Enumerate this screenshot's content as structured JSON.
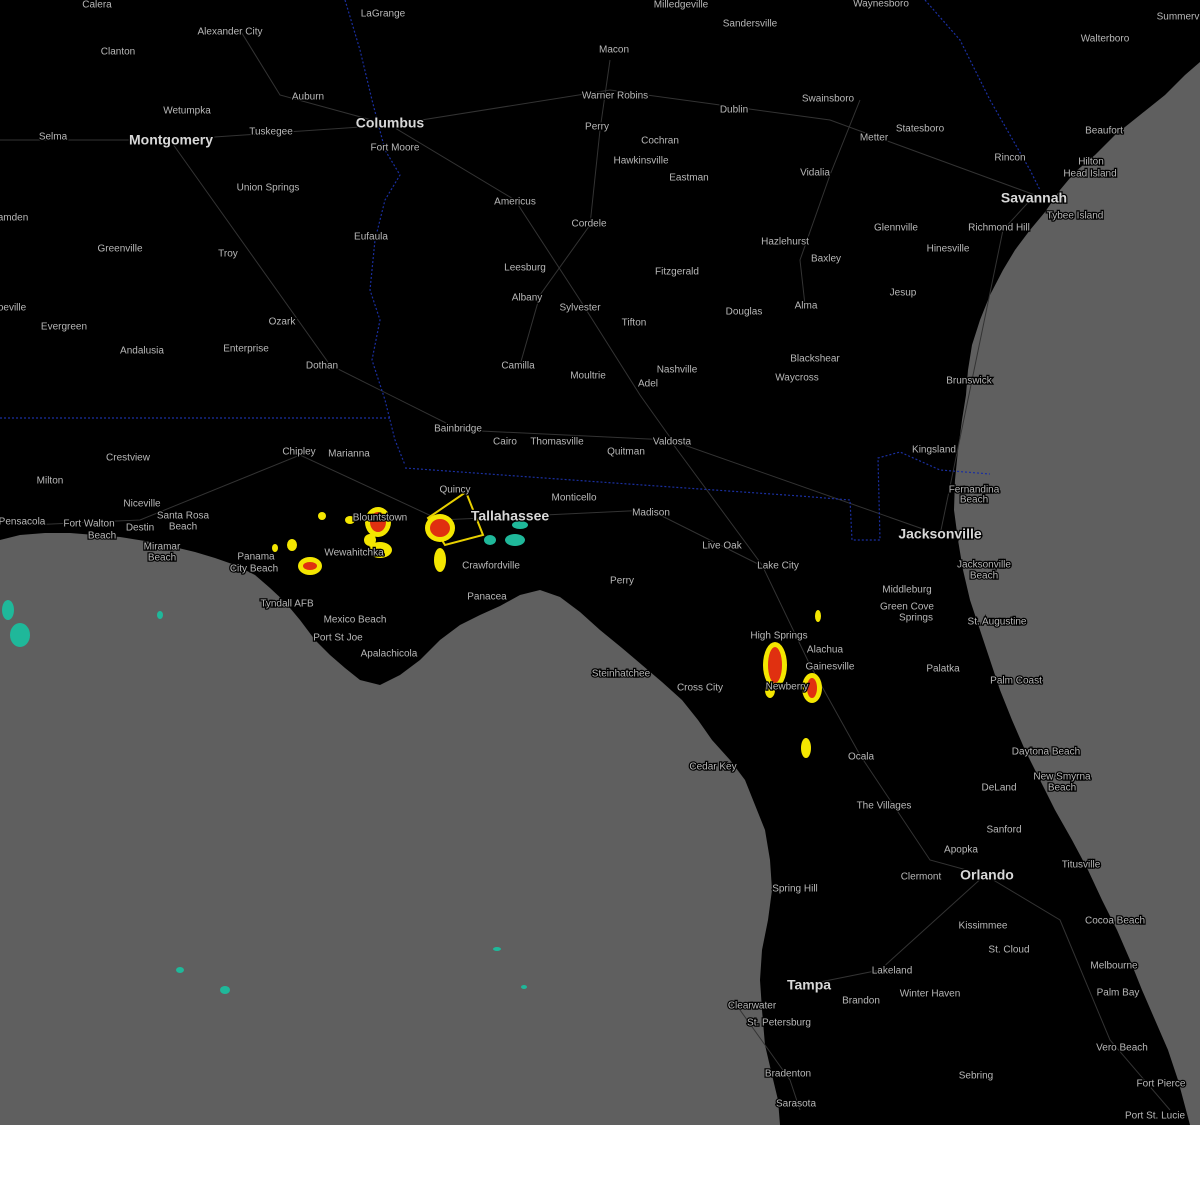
{
  "colors": {
    "land": "#000000",
    "water": "#5f5f5f",
    "state_border": "#1a2fa0",
    "roads": "#3a3a3a",
    "label": "#b8b8b8",
    "label_major": "#d8d8d8",
    "warning_box": "#e8d000",
    "radar_light": "#1fb89a",
    "radar_mid": "#f4e600",
    "radar_heavy": "#e03010"
  },
  "cities": [
    {
      "name": "Calera",
      "major": false
    },
    {
      "name": "LaGrange",
      "major": false
    },
    {
      "name": "Milledgeville",
      "major": false
    },
    {
      "name": "Waynesboro",
      "major": false
    },
    {
      "name": "Summerv",
      "major": false
    },
    {
      "name": "Alexander City",
      "major": false
    },
    {
      "name": "Sandersville",
      "major": false
    },
    {
      "name": "Walterboro",
      "major": false
    },
    {
      "name": "Clanton",
      "major": false
    },
    {
      "name": "Macon",
      "major": false
    },
    {
      "name": "Wetumpka",
      "major": false
    },
    {
      "name": "Auburn",
      "major": false
    },
    {
      "name": "Warner Robins",
      "major": false
    },
    {
      "name": "Dublin",
      "major": false
    },
    {
      "name": "Swainsboro",
      "major": false
    },
    {
      "name": "Selma",
      "major": false
    },
    {
      "name": "Montgomery",
      "major": true
    },
    {
      "name": "Tuskegee",
      "major": false
    },
    {
      "name": "Columbus",
      "major": true
    },
    {
      "name": "Perry",
      "major": false
    },
    {
      "name": "Statesboro",
      "major": false
    },
    {
      "name": "Beaufort",
      "major": false
    },
    {
      "name": "Fort Moore",
      "major": false
    },
    {
      "name": "Cochran",
      "major": false
    },
    {
      "name": "Metter",
      "major": false
    },
    {
      "name": "Hawkinsville",
      "major": false
    },
    {
      "name": "Rincon",
      "major": false
    },
    {
      "name": "Hilton",
      "major": false
    },
    {
      "name": "Head Island",
      "major": false
    },
    {
      "name": "Eastman",
      "major": false
    },
    {
      "name": "Vidalia",
      "major": false
    },
    {
      "name": "Union Springs",
      "major": false
    },
    {
      "name": "Americus",
      "major": false
    },
    {
      "name": "Savannah",
      "major": true
    },
    {
      "name": "Tybee Island",
      "major": false
    },
    {
      "name": "amden",
      "major": false
    },
    {
      "name": "Cordele",
      "major": false
    },
    {
      "name": "Glennville",
      "major": false
    },
    {
      "name": "Richmond Hill",
      "major": false
    },
    {
      "name": "Eufaula",
      "major": false
    },
    {
      "name": "Hazlehurst",
      "major": false
    },
    {
      "name": "Greenville",
      "major": false
    },
    {
      "name": "Troy",
      "major": false
    },
    {
      "name": "Hinesville",
      "major": false
    },
    {
      "name": "Baxley",
      "major": false
    },
    {
      "name": "Leesburg",
      "major": false
    },
    {
      "name": "Fitzgerald",
      "major": false
    },
    {
      "name": "Jesup",
      "major": false
    },
    {
      "name": "Albany",
      "major": false
    },
    {
      "name": "Sylvester",
      "major": false
    },
    {
      "name": "Alma",
      "major": false
    },
    {
      "name": "oeville",
      "major": false
    },
    {
      "name": "Douglas",
      "major": false
    },
    {
      "name": "Ozark",
      "major": false
    },
    {
      "name": "Tifton",
      "major": false
    },
    {
      "name": "Evergreen",
      "major": false
    },
    {
      "name": "Enterprise",
      "major": false
    },
    {
      "name": "Andalusia",
      "major": false
    },
    {
      "name": "Blackshear",
      "major": false
    },
    {
      "name": "Camilla",
      "major": false
    },
    {
      "name": "Dothan",
      "major": false
    },
    {
      "name": "Nashville",
      "major": false
    },
    {
      "name": "Moultrie",
      "major": false
    },
    {
      "name": "Waycross",
      "major": false
    },
    {
      "name": "Brunswick",
      "major": false
    },
    {
      "name": "Adel",
      "major": false
    },
    {
      "name": "Bainbridge",
      "major": false
    },
    {
      "name": "Cairo",
      "major": false
    },
    {
      "name": "Thomasville",
      "major": false
    },
    {
      "name": "Valdosta",
      "major": false
    },
    {
      "name": "Kingsland",
      "major": false
    },
    {
      "name": "Chipley",
      "major": false
    },
    {
      "name": "Marianna",
      "major": false
    },
    {
      "name": "Quitman",
      "major": false
    },
    {
      "name": "Crestview",
      "major": false
    },
    {
      "name": "Milton",
      "major": false
    },
    {
      "name": "Fernandina",
      "major": false
    },
    {
      "name": "Beach",
      "major": false
    },
    {
      "name": "Quincy",
      "major": false
    },
    {
      "name": "Monticello",
      "major": false
    },
    {
      "name": "Niceville",
      "major": false
    },
    {
      "name": "Pensacola",
      "major": false
    },
    {
      "name": "Fort Walton",
      "major": false
    },
    {
      "name": "Destin",
      "major": false
    },
    {
      "name": "Santa Rosa",
      "major": false
    },
    {
      "name": "Beach",
      "major": false
    },
    {
      "name": "Blountstown",
      "major": false
    },
    {
      "name": "Tallahassee",
      "major": true
    },
    {
      "name": "Madison",
      "major": false
    },
    {
      "name": "Jacksonville",
      "major": true
    },
    {
      "name": "Beach",
      "major": false
    },
    {
      "name": "Miramar",
      "major": false
    },
    {
      "name": "Beach",
      "major": false
    },
    {
      "name": "Live Oak",
      "major": false
    },
    {
      "name": "Panama",
      "major": false
    },
    {
      "name": "City Beach",
      "major": false
    },
    {
      "name": "Wewahitchka",
      "major": false
    },
    {
      "name": "Crawfordville",
      "major": false
    },
    {
      "name": "Lake City",
      "major": false
    },
    {
      "name": "Jacksonville",
      "major": false
    },
    {
      "name": "Beach",
      "major": false
    },
    {
      "name": "Perry",
      "major": false
    },
    {
      "name": "Middleburg",
      "major": false
    },
    {
      "name": "Panacea",
      "major": false
    },
    {
      "name": "Tyndall AFB",
      "major": false
    },
    {
      "name": "Green Cove",
      "major": false
    },
    {
      "name": "Springs",
      "major": false
    },
    {
      "name": "Mexico Beach",
      "major": false
    },
    {
      "name": "St. Augustine",
      "major": false
    },
    {
      "name": "Port St Joe",
      "major": false
    },
    {
      "name": "High Springs",
      "major": false
    },
    {
      "name": "Alachua",
      "major": false
    },
    {
      "name": "Apalachicola",
      "major": false
    },
    {
      "name": "Gainesville",
      "major": false
    },
    {
      "name": "Palatka",
      "major": false
    },
    {
      "name": "Steinhatchee",
      "major": false
    },
    {
      "name": "Palm Coast",
      "major": false
    },
    {
      "name": "Cross City",
      "major": false
    },
    {
      "name": "Newberry",
      "major": false
    },
    {
      "name": "Daytona Beach",
      "major": false
    },
    {
      "name": "Ocala",
      "major": false
    },
    {
      "name": "Cedar Key",
      "major": false
    },
    {
      "name": "New Smyrna",
      "major": false
    },
    {
      "name": "Beach",
      "major": false
    },
    {
      "name": "DeLand",
      "major": false
    },
    {
      "name": "The Villages",
      "major": false
    },
    {
      "name": "Sanford",
      "major": false
    },
    {
      "name": "Apopka",
      "major": false
    },
    {
      "name": "Titusville",
      "major": false
    },
    {
      "name": "Clermont",
      "major": false
    },
    {
      "name": "Orlando",
      "major": true
    },
    {
      "name": "Spring Hill",
      "major": false
    },
    {
      "name": "Cocoa Beach",
      "major": false
    },
    {
      "name": "Kissimmee",
      "major": false
    },
    {
      "name": "St. Cloud",
      "major": false
    },
    {
      "name": "Melbourne",
      "major": false
    },
    {
      "name": "Lakeland",
      "major": false
    },
    {
      "name": "Tampa",
      "major": true
    },
    {
      "name": "Winter Haven",
      "major": false
    },
    {
      "name": "Brandon",
      "major": false
    },
    {
      "name": "Palm Bay",
      "major": false
    },
    {
      "name": "Clearwater",
      "major": false
    },
    {
      "name": "St. Petersburg",
      "major": false
    },
    {
      "name": "Vero Beach",
      "major": false
    },
    {
      "name": "Bradenton",
      "major": false
    },
    {
      "name": "Sebring",
      "major": false
    },
    {
      "name": "Fort Pierce",
      "major": false
    },
    {
      "name": "Sarasota",
      "major": false
    },
    {
      "name": "Port St. Lucie",
      "major": false
    }
  ],
  "radar_cells": [
    {
      "level": "heavy"
    },
    {
      "level": "heavy"
    },
    {
      "level": "heavy"
    },
    {
      "level": "heavy"
    },
    {
      "level": "heavy"
    },
    {
      "level": "mid"
    },
    {
      "level": "mid"
    },
    {
      "level": "mid"
    },
    {
      "level": "mid"
    },
    {
      "level": "mid"
    },
    {
      "level": "mid"
    },
    {
      "level": "mid"
    },
    {
      "level": "mid"
    },
    {
      "level": "mid"
    },
    {
      "level": "mid"
    },
    {
      "level": "light"
    },
    {
      "level": "light"
    },
    {
      "level": "light"
    },
    {
      "level": "light"
    },
    {
      "level": "light"
    },
    {
      "level": "light"
    },
    {
      "level": "light"
    },
    {
      "level": "light"
    },
    {
      "level": "light"
    },
    {
      "level": "light"
    }
  ],
  "warning_polygon": {
    "label": "warning-area"
  }
}
